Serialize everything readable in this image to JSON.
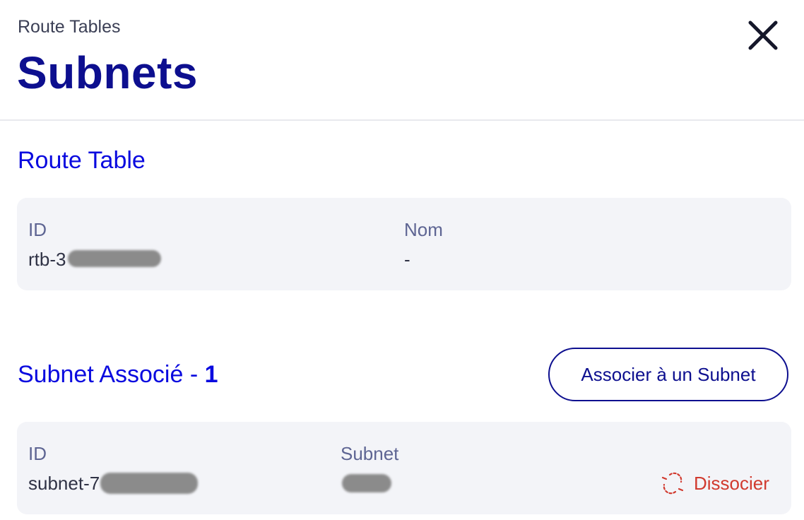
{
  "header": {
    "breadcrumb": "Route Tables",
    "title": "Subnets",
    "close_icon": "close-icon"
  },
  "route_table": {
    "section_title": "Route Table",
    "id_label": "ID",
    "id_value": "rtb-3",
    "name_label": "Nom",
    "name_value": "-"
  },
  "associated": {
    "section_title": "Subnet Associé - ",
    "count": "1",
    "associate_button": "Associer à un Subnet",
    "rows": [
      {
        "id_label": "ID",
        "id_value": "subnet-7",
        "subnet_label": "Subnet",
        "subnet_value": "",
        "dissociate_label": "Dissocier",
        "dissociate_icon": "unlink-icon"
      }
    ]
  },
  "colors": {
    "title": "#0d0f8f",
    "section": "#0a0adf",
    "card_bg": "#f3f4f8",
    "label": "#5e6593",
    "danger": "#d13a2f"
  }
}
